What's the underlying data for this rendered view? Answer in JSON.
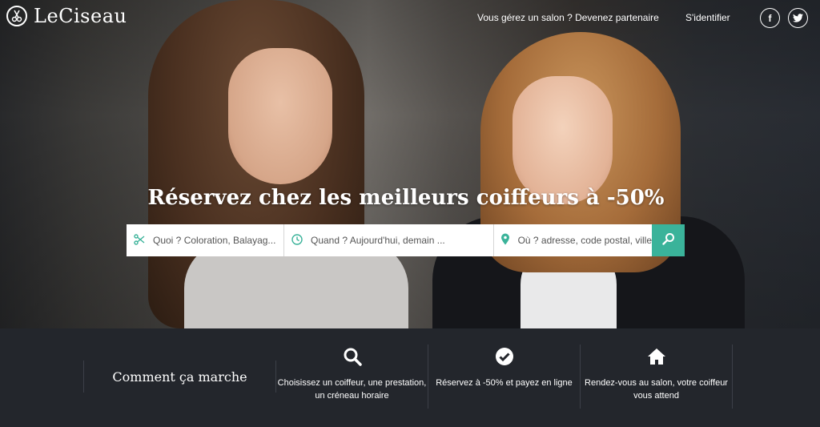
{
  "header": {
    "logo_text": "LeCiseau",
    "partner_link": "Vous gérez un salon ? Devenez partenaire",
    "login_link": "S'identifier",
    "facebook_label": "f",
    "twitter_label": "t"
  },
  "hero": {
    "headline": "Réservez chez les meilleurs coiffeurs à -50%"
  },
  "search": {
    "what_placeholder": "Quoi ? Coloration, Balayag...",
    "when_placeholder": "Quand ? Aujourd'hui, demain ...",
    "where_placeholder": "Où ? adresse, code postal, ville",
    "what_icon": "scissors-icon",
    "when_icon": "clock-icon",
    "where_icon": "map-pin-icon",
    "button_icon": "search-icon"
  },
  "how_it_works": {
    "title": "Comment ça marche",
    "steps": [
      {
        "icon": "search-icon",
        "text": "Choisissez un coiffeur, une prestation, un créneau horaire"
      },
      {
        "icon": "check-circle-icon",
        "text": "Réservez à -50% et payez en ligne"
      },
      {
        "icon": "home-icon",
        "text": "Rendez-vous au salon, votre coiffeur vous attend"
      }
    ]
  },
  "colors": {
    "accent": "#3ab39a",
    "strip_background": "#23262c"
  }
}
